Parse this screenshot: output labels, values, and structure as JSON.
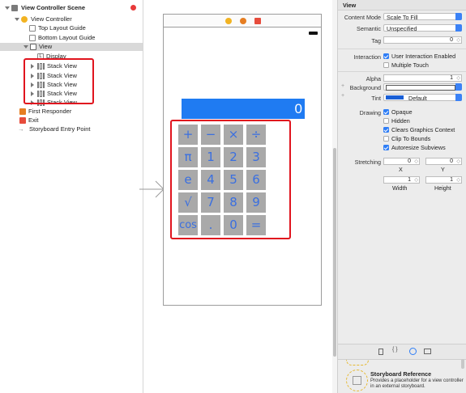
{
  "outline": {
    "scene_title": "View Controller Scene",
    "view_controller": "View Controller",
    "top_guide": "Top Layout Guide",
    "bottom_guide": "Bottom Layout Guide",
    "view": "View",
    "display": "Display",
    "stack_views": [
      "Stack View",
      "Stack View",
      "Stack View",
      "Stack View",
      "Stack View"
    ],
    "first_responder": "First Responder",
    "exit": "Exit",
    "entry_point": "Storyboard Entry Point"
  },
  "canvas": {
    "display_value": "0",
    "rows": [
      [
        "+",
        "−",
        "×",
        "÷"
      ],
      [
        "π",
        "1",
        "2",
        "3"
      ],
      [
        "e",
        "4",
        "5",
        "6"
      ],
      [
        "√",
        "7",
        "8",
        "9"
      ],
      [
        "cos",
        ".",
        "0",
        "="
      ]
    ]
  },
  "inspector": {
    "section": "View",
    "content_mode_label": "Content Mode",
    "content_mode_value": "Scale To Fill",
    "semantic_label": "Semantic",
    "semantic_value": "Unspecified",
    "tag_label": "Tag",
    "tag_value": "0",
    "interaction_label": "Interaction",
    "user_interaction": "User Interaction Enabled",
    "multiple_touch": "Multiple Touch",
    "alpha_label": "Alpha",
    "alpha_value": "1",
    "background_label": "Background",
    "tint_label": "Tint",
    "tint_value": "Default",
    "drawing_label": "Drawing",
    "opaque": "Opaque",
    "hidden": "Hidden",
    "clears": "Clears Graphics Context",
    "clip": "Clip To Bounds",
    "autoresize": "Autoresize Subviews",
    "stretching_label": "Stretching",
    "stretch_x": "0",
    "stretch_y": "0",
    "stretch_w": "1",
    "stretch_h": "1",
    "x_label": "X",
    "y_label": "Y",
    "width_label": "Width",
    "height_label": "Height",
    "library_title": "Storyboard Reference",
    "library_desc": "Provides a placeholder for a view controller in an external storyboard."
  },
  "colors": {
    "accent": "#2f7ef6",
    "highlight_red": "#e0141e",
    "key_gray": "#a9a9a9",
    "key_text": "#3a6fe0",
    "display_blue": "#1f7bf2"
  }
}
